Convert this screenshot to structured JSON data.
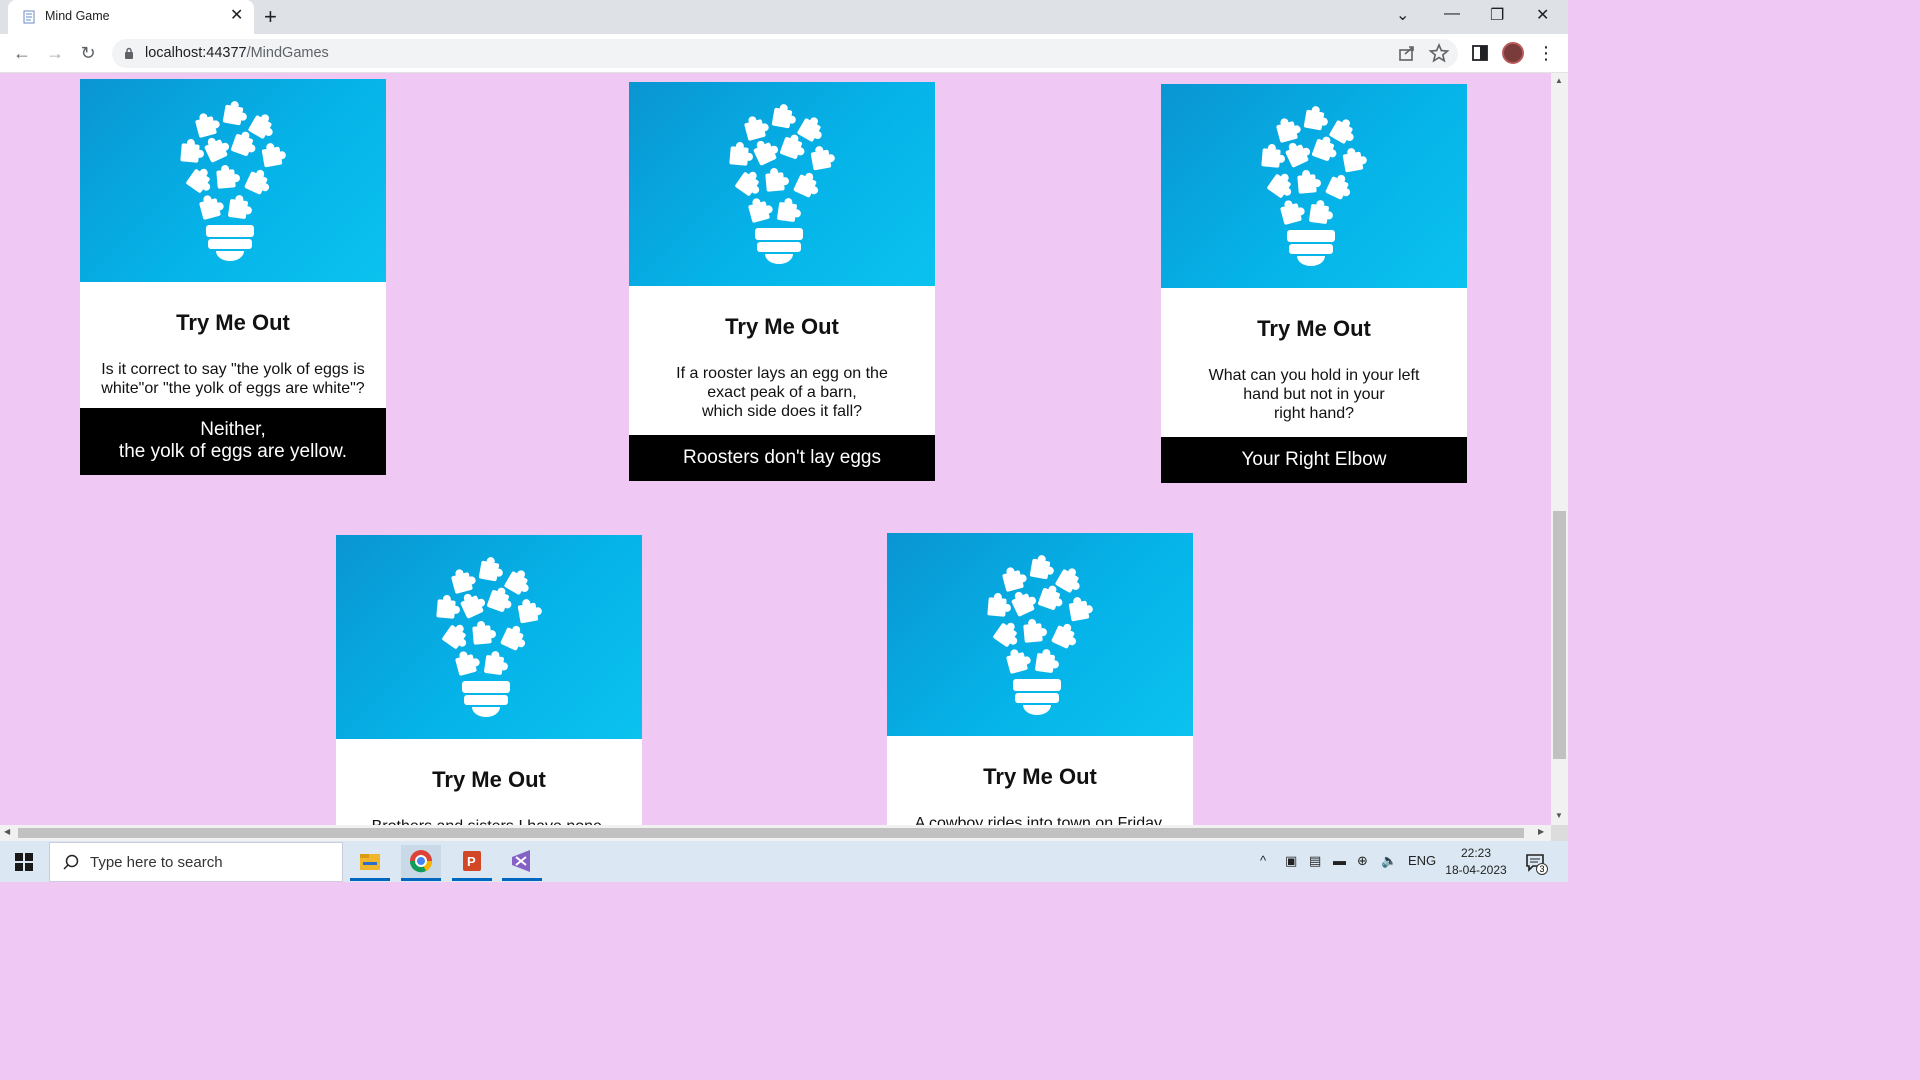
{
  "browser": {
    "tab_title": "Mind Game",
    "url_host": "localhost:44377",
    "url_path": "/MindGames"
  },
  "cards": [
    {
      "title": "Try Me Out",
      "question": "Is it correct to say \"the yolk of eggs is\nwhite\"or \"the yolk of eggs are white\"?",
      "answer": "Neither,\nthe yolk of eggs are yellow."
    },
    {
      "title": "Try Me Out",
      "question": "If a rooster lays an egg on the\nexact peak of a barn,\nwhich side does it fall?",
      "answer": "Roosters don't lay eggs"
    },
    {
      "title": "Try Me Out",
      "question": "What can you hold in your left\nhand but not in your\nright hand?",
      "answer": "Your Right Elbow"
    },
    {
      "title": "Try Me Out",
      "question": "Brothers and sisters I have none,",
      "answer": ""
    },
    {
      "title": "Try Me Out",
      "question": "A cowboy rides into town on Friday,",
      "answer": ""
    }
  ],
  "taskbar": {
    "search_placeholder": "Type here to search",
    "lang": "ENG",
    "time": "22:23",
    "date": "18-04-2023",
    "notif_count": "3"
  },
  "colors": {
    "page_bg": "#f0c8f4",
    "card_image": "#05b3e8",
    "answer_bg": "#000000"
  }
}
